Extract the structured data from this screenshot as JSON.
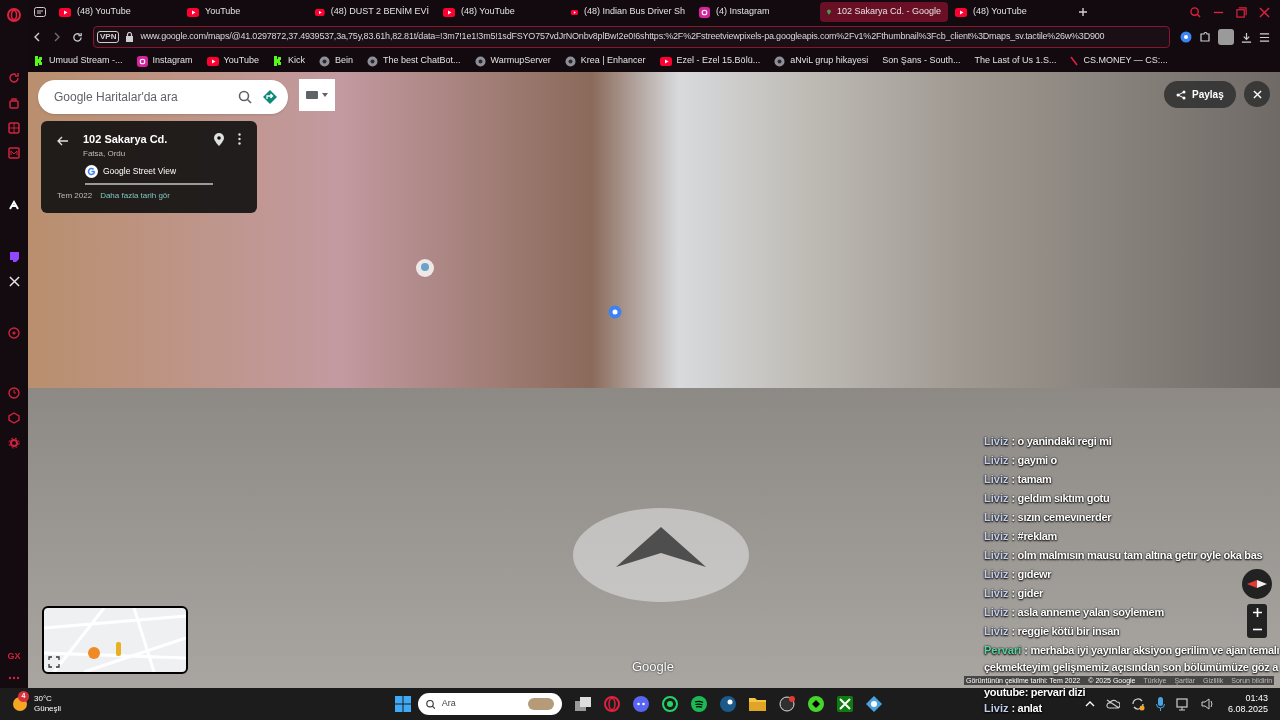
{
  "browser": {
    "tabs": [
      {
        "title": "(48) YouTube",
        "kind": "youtube",
        "selected": false
      },
      {
        "title": "YouTube",
        "kind": "youtube",
        "selected": false
      },
      {
        "title": "(48) DUST 2 BENİM EVİ",
        "kind": "youtube",
        "selected": false
      },
      {
        "title": "(48) YouTube",
        "kind": "youtube",
        "selected": false
      },
      {
        "title": "(48) Indian Bus Driver Sh",
        "kind": "youtube",
        "selected": false
      },
      {
        "title": "(4) Instagram",
        "kind": "instagram",
        "selected": false
      },
      {
        "title": "102 Sakarya Cd. - Google",
        "kind": "maps",
        "selected": true
      },
      {
        "title": "(48) YouTube",
        "kind": "youtube",
        "selected": false
      }
    ],
    "vpn_badge": "VPN",
    "address": "www.google.com/maps/@41.0297872,37.4939537,3a,75y,83.61h,82.81t/data=!3m7!1e1!3m5!1sdFSYO757vdJrNOnbv8plBw!2e0!6shttps:%2F%2Fstreetviewpixels-pa.googleapis.com%2Fv1%2Fthumbnail%3Fcb_client%3Dmaps_sv.tactile%26w%3D900",
    "bookmarks": [
      {
        "label": "Umuud Stream -...",
        "kind": "kick"
      },
      {
        "label": "Instagram",
        "kind": "instagram"
      },
      {
        "label": "YouTube",
        "kind": "youtube"
      },
      {
        "label": "Kick",
        "kind": "kick"
      },
      {
        "label": "Bein",
        "kind": "generic"
      },
      {
        "label": "The best ChatBot...",
        "kind": "generic"
      },
      {
        "label": "WarmupServer",
        "kind": "generic"
      },
      {
        "label": "Krea | Enhancer",
        "kind": "generic"
      },
      {
        "label": "Ezel - Ezel 15.Bölü...",
        "kind": "youtube"
      },
      {
        "label": "aNviL grup hikayesi",
        "kind": "generic"
      },
      {
        "label": "Son Şans - South...",
        "kind": "plain"
      },
      {
        "label": "The Last of Us 1.S...",
        "kind": "plain"
      },
      {
        "label": "CS.MONEY — CS:...",
        "kind": "slash"
      }
    ],
    "sidebar_label": "GX"
  },
  "maps": {
    "search": {
      "placeholder": "Google Haritalar'da ara"
    },
    "place_card": {
      "title": "102 Sakarya Cd.",
      "subtitle": "Fatsa, Ordu",
      "source": "Google Street View",
      "date": "Tem 2022",
      "history_link": "Daha fazla tarih gör"
    },
    "share_button": "Paylaş",
    "wordmark": "Google",
    "footer": [
      "Görüntünün çekilme tarihi: Tem 2022",
      "© 2025 Google",
      "Türkiye",
      "Şartlar",
      "Gizlilik",
      "Sorun bildirin"
    ]
  },
  "chat": [
    {
      "name": "Liviz",
      "color": "#c3cdec",
      "lines": [
        ": o yanindaki regi mi"
      ]
    },
    {
      "name": "Liviz",
      "color": "#c3cdec",
      "lines": [
        ": gaymi o"
      ]
    },
    {
      "name": "Liviz",
      "color": "#c3cdec",
      "lines": [
        ": tamam"
      ]
    },
    {
      "name": "Liviz",
      "color": "#c3cdec",
      "lines": [
        ": geldım sıktım gotu"
      ]
    },
    {
      "name": "Liviz",
      "color": "#c3cdec",
      "lines": [
        ": sızın cemevınerder"
      ]
    },
    {
      "name": "Liviz",
      "color": "#c3cdec",
      "lines": [
        ": #reklam"
      ]
    },
    {
      "name": "Liviz",
      "color": "#c3cdec",
      "lines": [
        ": olm malmısın mausu tam altına getır oyle oka bas"
      ]
    },
    {
      "name": "Liviz",
      "color": "#c3cdec",
      "lines": [
        ": gıdewr"
      ]
    },
    {
      "name": "Liviz",
      "color": "#c3cdec",
      "lines": [
        ": gider"
      ]
    },
    {
      "name": "Liviz",
      "color": "#c3cdec",
      "lines": [
        ": asla anneme yalan soylemem"
      ]
    },
    {
      "name": "Liviz",
      "color": "#c3cdec",
      "lines": [
        ": reggie kötü bir insan"
      ]
    },
    {
      "name": "Pervari",
      "color": "#5fd39c",
      "lines": [
        ": merhaba iyi yayınlar aksiyon gerilim ve ajan temalı",
        "çekmekteyim gelişmemiz açısından son bölümümüze göz a",
        "youtube: pervari dizi"
      ]
    },
    {
      "name": "Liviz",
      "color": "#c3cdec",
      "lines": [
        ": anlat"
      ]
    }
  ],
  "taskbar": {
    "weather": {
      "temperature": "30°C",
      "condition": "Güneşli",
      "badge": "4"
    },
    "search": {
      "placeholder": "Ara"
    },
    "clock": {
      "time": "01:43",
      "date": "6.08.2025"
    }
  }
}
